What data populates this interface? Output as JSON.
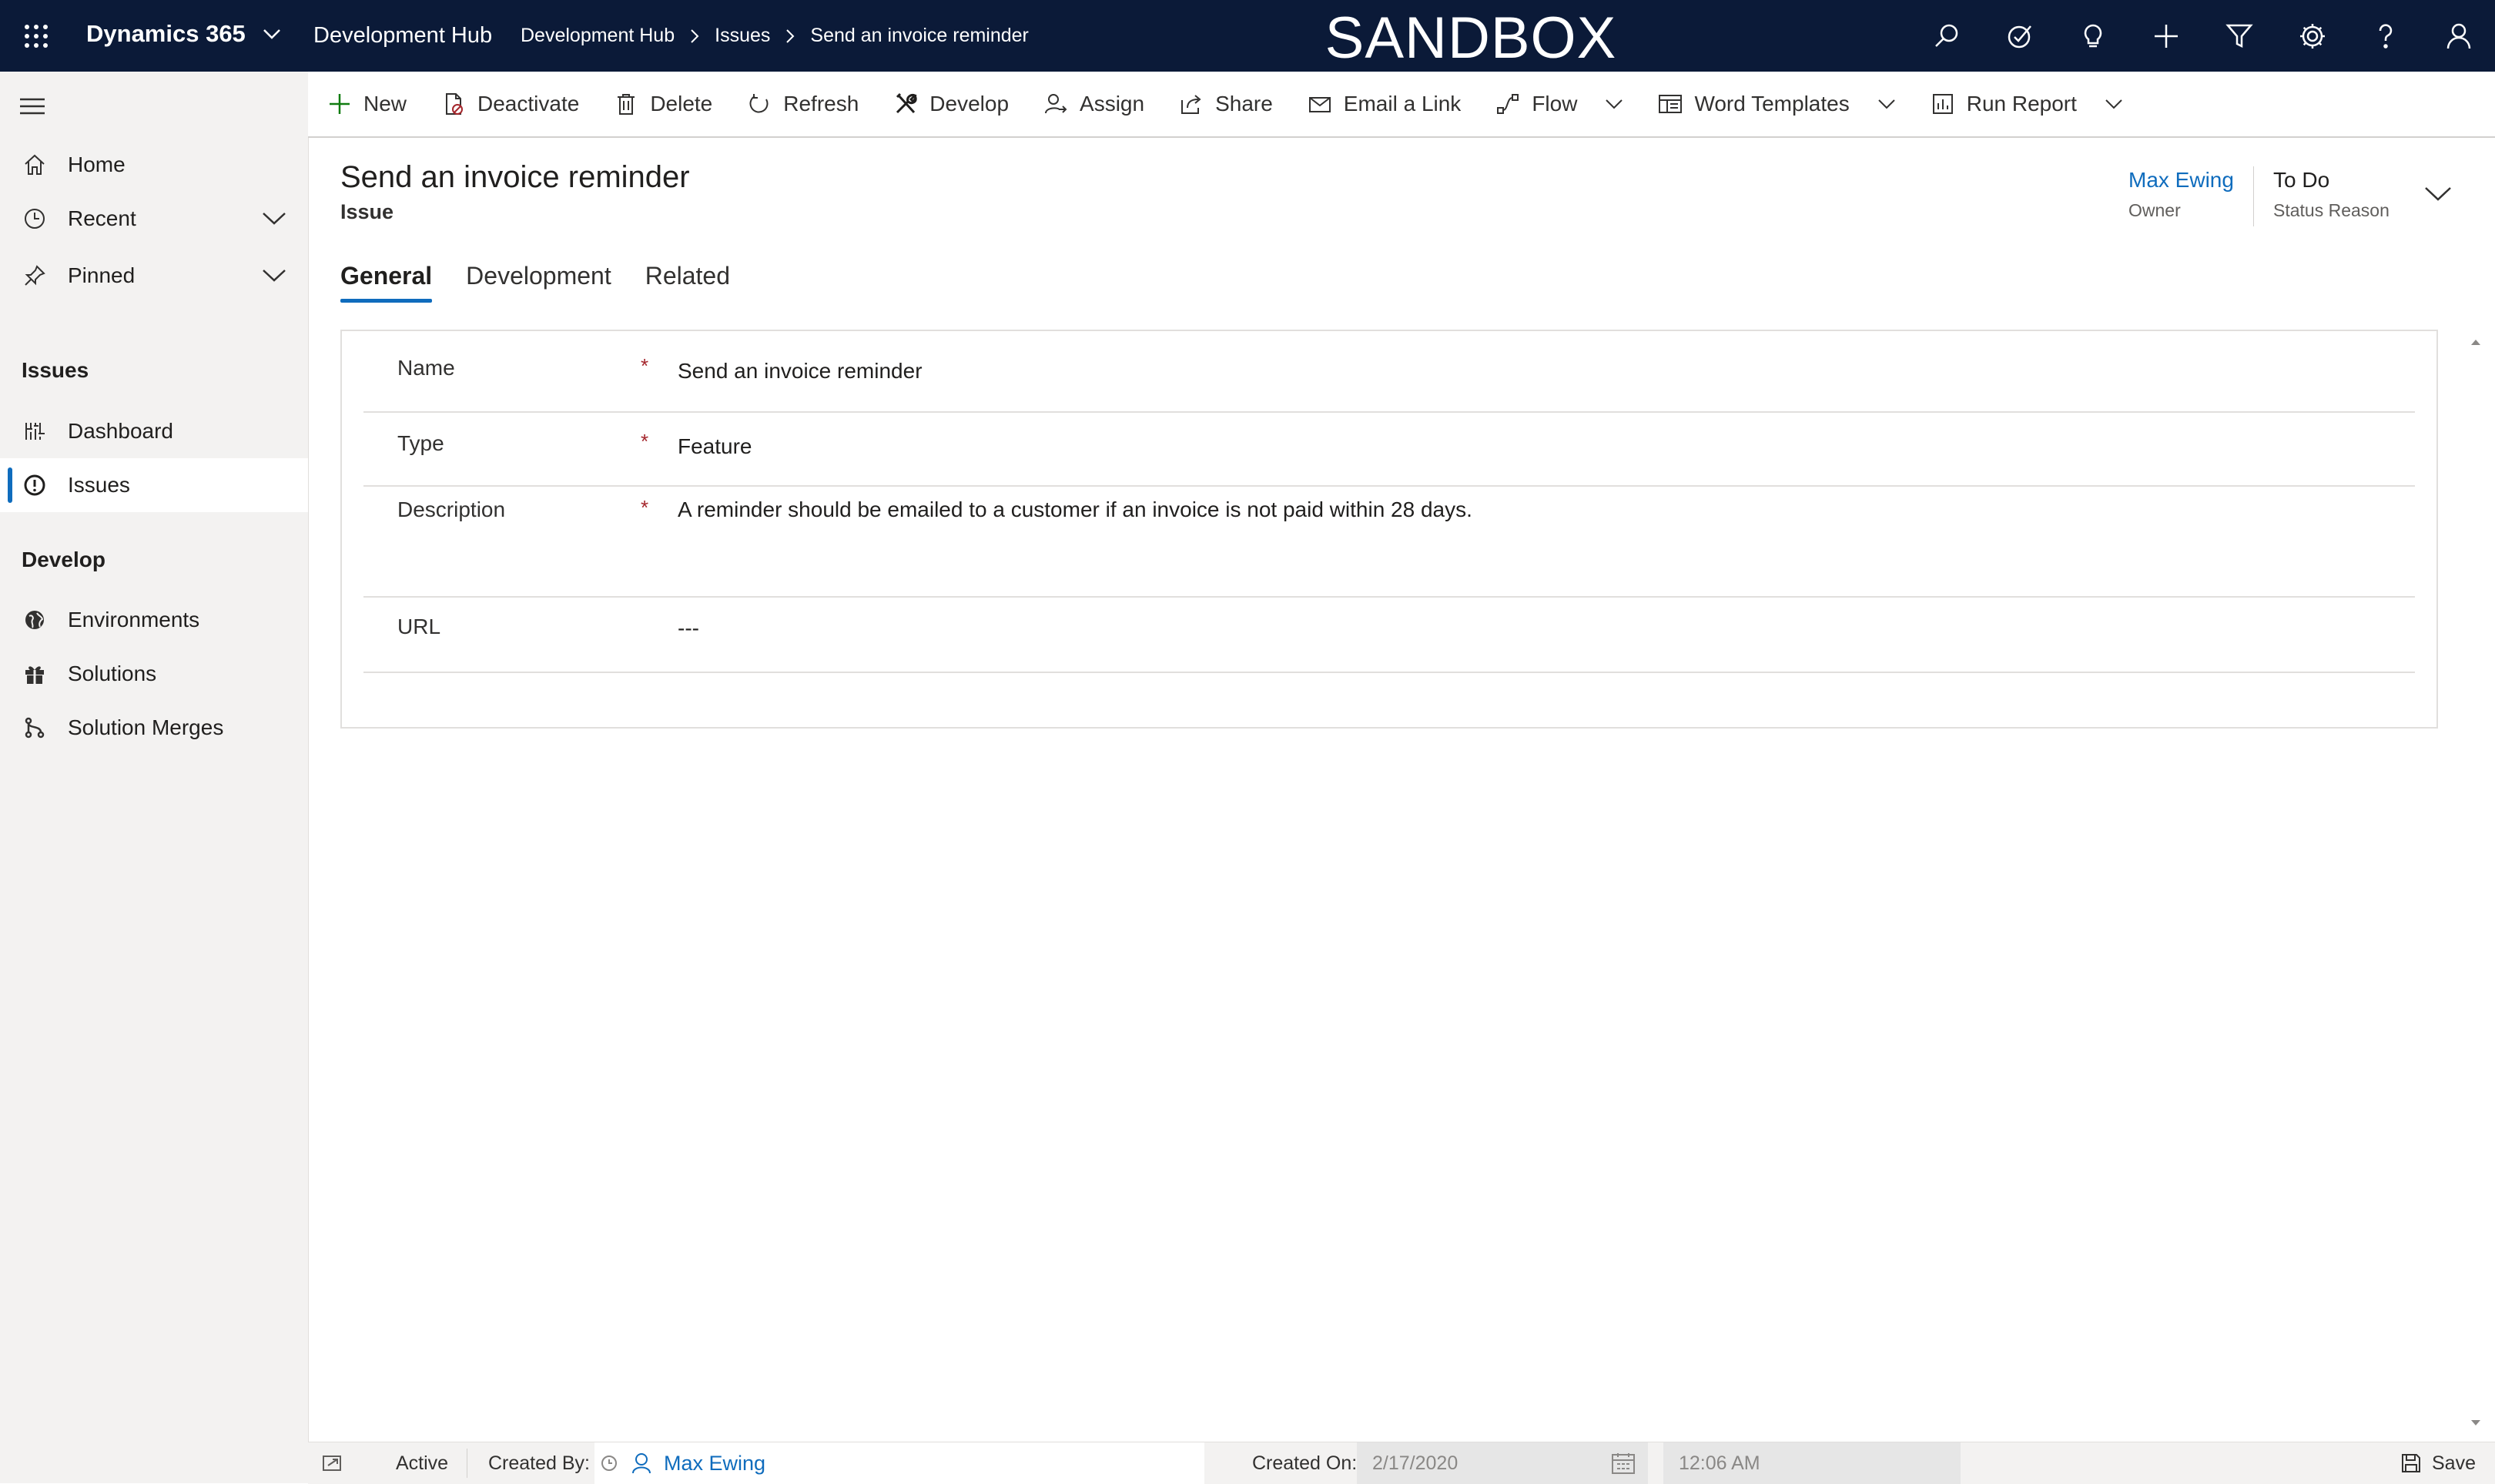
{
  "topbar": {
    "app_name": "Dynamics 365",
    "app_subtitle": "Development Hub",
    "breadcrumb": [
      "Development Hub",
      "Issues",
      "Send an invoice reminder"
    ],
    "banner": "SANDBOX",
    "icons": [
      "search-icon",
      "task-check-icon",
      "lightbulb-icon",
      "plus-icon",
      "filter-icon",
      "settings-icon",
      "help-icon",
      "user-icon"
    ],
    "background_color": "#0b1a38"
  },
  "sitemap": {
    "items_top": [
      {
        "label": "Home",
        "icon": "home-icon"
      },
      {
        "label": "Recent",
        "icon": "clock-icon"
      },
      {
        "label": "Pinned",
        "icon": "pin-icon"
      }
    ],
    "groups": [
      {
        "title": "Issues",
        "items": [
          {
            "label": "Dashboard",
            "icon": "dashboard-icon"
          },
          {
            "label": "Issues",
            "icon": "issue-icon",
            "selected": true
          }
        ]
      },
      {
        "title": "Develop",
        "items": [
          {
            "label": "Environments",
            "icon": "globe-icon"
          },
          {
            "label": "Solutions",
            "icon": "gift-icon"
          },
          {
            "label": "Solution Merges",
            "icon": "merge-icon"
          }
        ]
      }
    ]
  },
  "commands": [
    {
      "label": "New",
      "icon": "plus-icon"
    },
    {
      "label": "Deactivate",
      "icon": "deactivate-icon"
    },
    {
      "label": "Delete",
      "icon": "trash-icon"
    },
    {
      "label": "Refresh",
      "icon": "refresh-icon"
    },
    {
      "label": "Develop",
      "icon": "tools-icon"
    },
    {
      "label": "Assign",
      "icon": "assign-icon"
    },
    {
      "label": "Share",
      "icon": "share-icon"
    },
    {
      "label": "Email a Link",
      "icon": "email-icon"
    },
    {
      "label": "Flow",
      "icon": "flow-icon",
      "has_menu": true
    },
    {
      "label": "Word Templates",
      "icon": "word-icon",
      "has_menu": true
    },
    {
      "label": "Run Report",
      "icon": "report-icon",
      "has_menu": true
    }
  ],
  "record": {
    "title": "Send an invoice reminder",
    "entity": "Issue",
    "owner": {
      "value": "Max Ewing",
      "label": "Owner"
    },
    "status_reason": {
      "value": "To Do",
      "label": "Status Reason"
    }
  },
  "tabs": [
    {
      "label": "General",
      "selected": true
    },
    {
      "label": "Development"
    },
    {
      "label": "Related"
    }
  ],
  "form": {
    "fields": [
      {
        "label": "Name",
        "required": true,
        "value": "Send an invoice reminder"
      },
      {
        "label": "Type",
        "required": true,
        "value": "Feature"
      },
      {
        "label": "Description",
        "required": true,
        "value": "A reminder should be emailed to a customer if an invoice is not paid within 28 days."
      },
      {
        "label": "URL",
        "required": false,
        "value": "---"
      }
    ],
    "required_marker": "*"
  },
  "footer": {
    "status": "Active",
    "created_by_label": "Created By:",
    "created_by_value": "Max Ewing",
    "created_on_label": "Created On:",
    "created_on_date": "2/17/2020",
    "created_on_time": "12:06 AM",
    "save_label": "Save"
  },
  "colors": {
    "accent": "#0f6cbd",
    "required": "#a4262c",
    "sitemap_bg": "#f3f2f1"
  }
}
